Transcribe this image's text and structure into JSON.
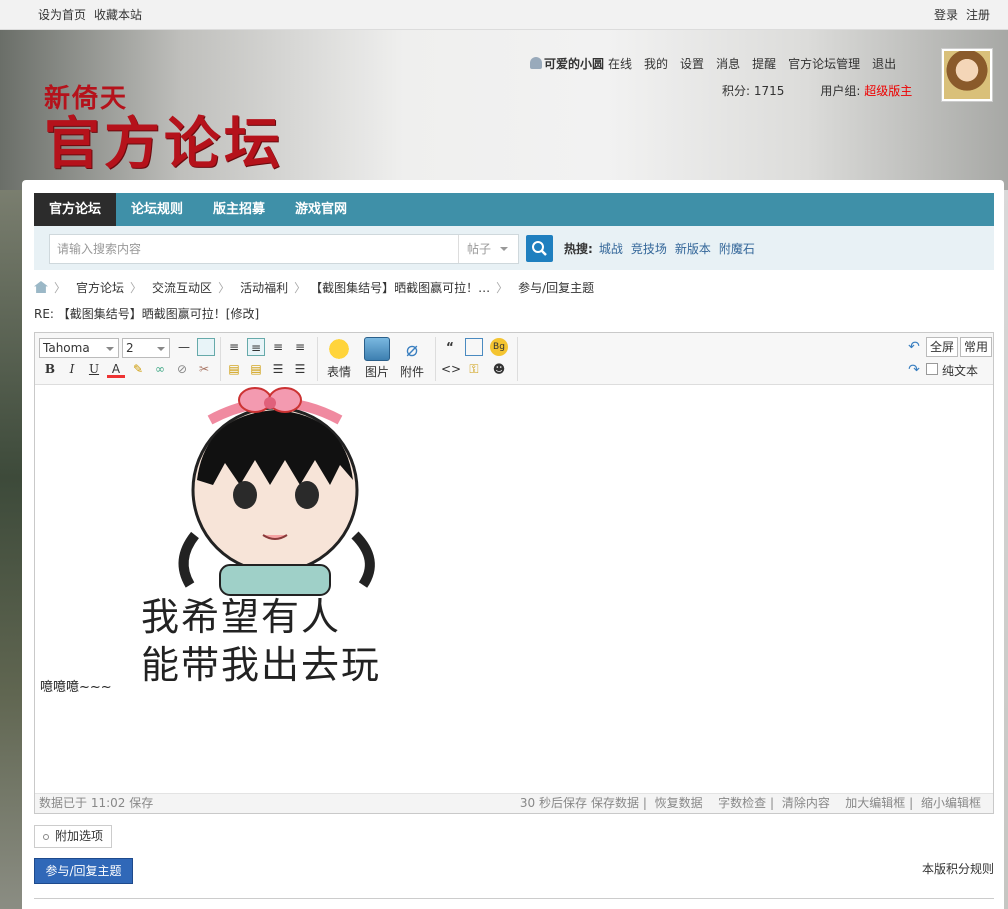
{
  "topbar": {
    "set_home": "设为首页",
    "bookmark": "收藏本站",
    "login": "登录",
    "register": "注册"
  },
  "logo": {
    "small": "新倚天",
    "big": "官方论坛"
  },
  "user": {
    "name": "可爱的小圆",
    "status": "在线",
    "mine": "我的",
    "settings": "设置",
    "messages": "消息",
    "remind": "提醒",
    "admin": "官方论坛管理",
    "logout": "退出",
    "points_label": "积分: 1715",
    "group_label": "用户组:",
    "group_value": "超级版主"
  },
  "nav": [
    {
      "label": "官方论坛"
    },
    {
      "label": "论坛规则"
    },
    {
      "label": "版主招募"
    },
    {
      "label": "游戏官网"
    }
  ],
  "search": {
    "placeholder": "请输入搜索内容",
    "scope": "帖子",
    "hot_label": "热搜:",
    "hot": [
      "城战",
      "竞技场",
      "新版本",
      "附魔石"
    ]
  },
  "breadcrumb": [
    "官方论坛",
    "交流互动区",
    "活动福利",
    "【截图集结号】晒截图赢可拉！…",
    "参与/回复主题"
  ],
  "reply_title": "RE: 【截图集结号】晒截图赢可拉！[修改]",
  "toolbar": {
    "font": "Tahoma",
    "size": "2",
    "emoji": "表情",
    "image": "图片",
    "attachment": "附件",
    "fullscreen": "全屏",
    "common": "常用",
    "plaintext": "纯文本"
  },
  "editor": {
    "sticker_line1": "我希望有人",
    "sticker_line2": "能带我出去玩",
    "message": "噫噫噫~~~",
    "status_left": "数据已于 11:02 保存",
    "autosave": "30 秒后保存",
    "save": "保存数据",
    "restore": "恢复数据",
    "wordcount": "字数检查",
    "clear": "清除内容",
    "enlarge": "加大编辑框",
    "shrink": "缩小编辑框"
  },
  "attach_options": "附加选项",
  "submit": "参与/回复主题",
  "rules": "本版积分规则",
  "colors": {
    "nav": "#3f90a8",
    "accent": "#b5121b",
    "submit": "#3068b8"
  }
}
